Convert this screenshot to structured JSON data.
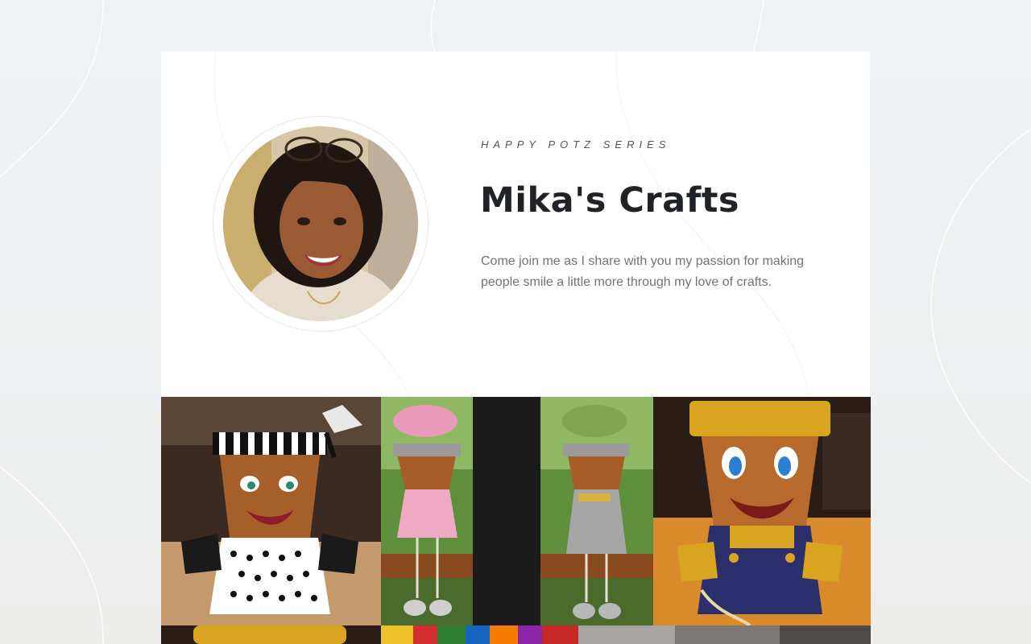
{
  "profile": {
    "kicker": "HAPPY POTZ SERIES",
    "name": "Mika's Crafts",
    "description": "Come join me as I share with you my passion for making people smile a little more through my love of crafts."
  },
  "gallery": {
    "photos": [
      {
        "subject": "black-and-white polka dot clay pot person"
      },
      {
        "subject": "pink and gray clay pot couple with flowers"
      },
      {
        "subject": "gold and navy clay pot person in overalls"
      },
      {
        "subject": "gold clay pot"
      },
      {
        "subject": "multicolor painted clay pot"
      },
      {
        "subject": "clay pot photo"
      }
    ]
  },
  "colors": {
    "page_bg": "#eef2f5",
    "card_bg": "#ffffff",
    "title": "#1f2328",
    "text_muted": "#6f747a",
    "terracotta": "#b86a2c",
    "gold": "#d9a521",
    "navy": "#2b2f6b"
  }
}
